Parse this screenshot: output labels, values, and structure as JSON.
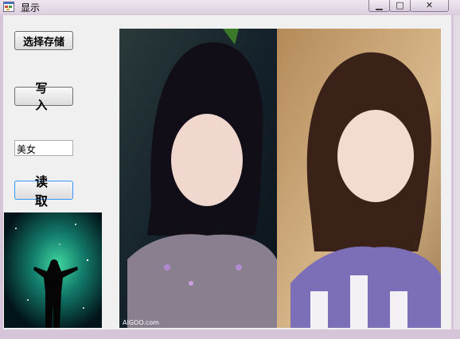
{
  "window": {
    "title": "显示",
    "minimize_glyph": "▁",
    "maximize_glyph": "□",
    "close_glyph": "✕"
  },
  "form": {
    "select_button_label": "选择存储",
    "write_button_label": "写入",
    "text_value": "美女",
    "read_button_label": "读取"
  },
  "images": {
    "watermark": "AIGOO.com"
  },
  "icons": {
    "app": "app-icon",
    "minimize": "minimize-icon",
    "maximize": "maximize-icon",
    "close": "close-icon"
  },
  "colors": {
    "frame": "#d6c5d9",
    "client": "#f0f0f0",
    "focus_border": "#3399ff"
  }
}
